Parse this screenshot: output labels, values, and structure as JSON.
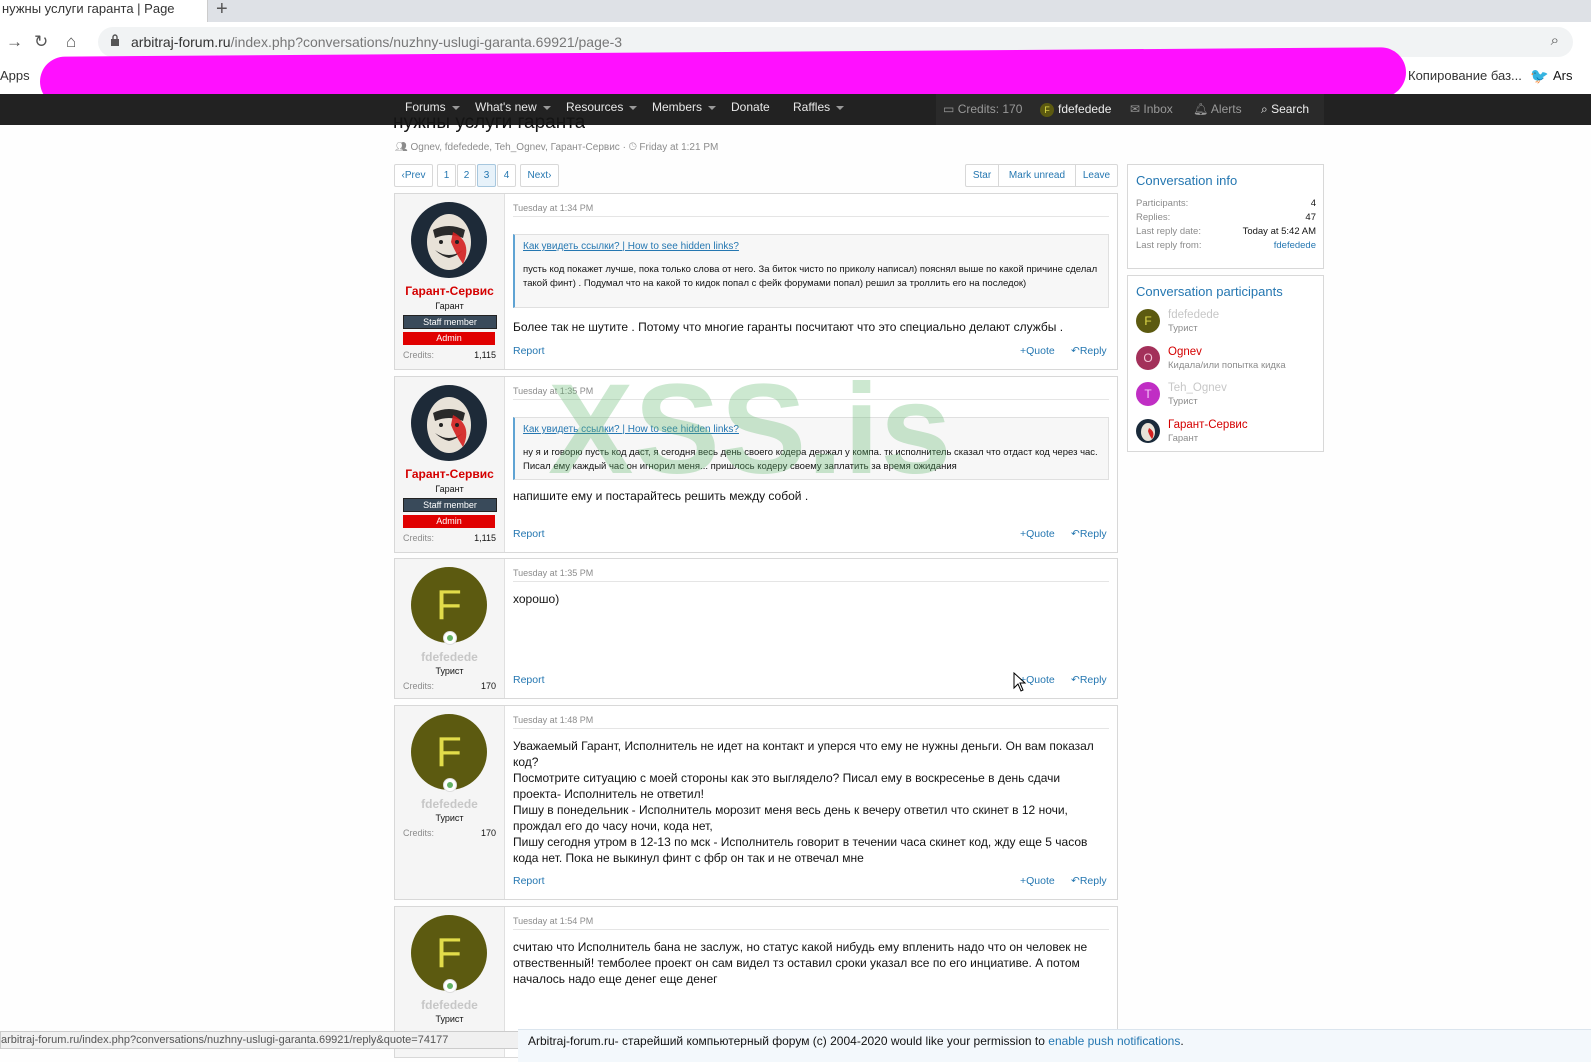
{
  "browser": {
    "tab_title": "нужны услуги гаранта | Page",
    "url_host": "arbitraj-forum.ru",
    "url_path": "/index.php?conversations/nuzhny-uslugi-garanta.69921/page-3",
    "apps_label": "Apps",
    "bookmark_right": "Копирование баз...",
    "bookmark_far": "Ars"
  },
  "nav": {
    "items": [
      "Forums",
      "What's new",
      "Resources",
      "Members",
      "Donate",
      "Raffles"
    ],
    "credits": "Credits: 170",
    "user": "fdefedede",
    "user_initial": "F",
    "inbox": "Inbox",
    "alerts": "Alerts",
    "search": "Search"
  },
  "page": {
    "title": "нужны услуги гаранта",
    "meta_participants": "Ognev, fdefedede, Teh_Ognev, Гарант-Сервис",
    "meta_date": "Friday at 1:21 PM"
  },
  "pager": {
    "prev": "Prev",
    "pages": [
      "1",
      "2",
      "3",
      "4"
    ],
    "current": "3",
    "next": "Next"
  },
  "actions": {
    "star": "Star",
    "mark_unread": "Mark unread",
    "leave": "Leave"
  },
  "messages": [
    {
      "user": "Гарант-Сервис",
      "user_title": "Гарант",
      "staff_badge": "Staff member",
      "admin_badge": "Admin",
      "credits_label": "Credits:",
      "credits": "1,115",
      "date": "Tuesday at 1:34 PM",
      "quote_link": "Как увидеть ссылки? | How to see hidden links?",
      "quote_text": "пусть код покажет лучше, пока только слова от него. За биток чисто по приколу написал) пояснял выше по какой причине сделал такой финт) . Подумал что на какой то кидок попал с фейк форумами попал) решил за троллить его на последок)",
      "body": "Более так не шутите . Потому что многие гаранты посчитают что это специально делают службы .",
      "report": "Report",
      "quote": "Quote",
      "reply": "Reply"
    },
    {
      "user": "Гарант-Сервис",
      "user_title": "Гарант",
      "staff_badge": "Staff member",
      "admin_badge": "Admin",
      "credits_label": "Credits:",
      "credits": "1,115",
      "date": "Tuesday at 1:35 PM",
      "quote_link": "Как увидеть ссылки? | How to see hidden links?",
      "quote_text": "ну я и говорю пусть код даст, я сегодня весь день своего кодера держал у компа. тк исполнитель сказал что отдаст код через час. Писал ему каждый час он игнорил меня... пришлось кодеру своему заплатить за время ожидания",
      "body": "напишите ему и постарайтесь решить между собой .",
      "report": "Report",
      "quote": "Quote",
      "reply": "Reply"
    },
    {
      "user": "fdefedede",
      "user_initial": "F",
      "user_title": "Турист",
      "credits_label": "Credits:",
      "credits": "170",
      "date": "Tuesday at 1:35 PM",
      "body": "хорошо)",
      "report": "Report",
      "quote": "Quote",
      "reply": "Reply"
    },
    {
      "user": "fdefedede",
      "user_initial": "F",
      "user_title": "Турист",
      "credits_label": "Credits:",
      "credits": "170",
      "date": "Tuesday at 1:48 PM",
      "body_lines": [
        "Уважаемый Гарант, Исполнитель не идет на контакт и уперся что ему не нужны деньги. Он вам показал код?",
        "Посмотрите ситуацию с моей стороны как это выглядело? Писал ему в воскресенье в день сдачи проекта- Исполнитель не ответил!",
        "Пишу в понедельник - Исполнитель морозит меня весь день к вечеру ответил что скинет в 12 ночи, прождал его до часу ночи, кода нет,",
        "Пишу сегодня утром в 12-13 по мск - Исполнитель говорит в течении часа скинет код, жду еще 5 часов кода нет. Пока не выкинул финт с фбр он так и не отвечал мне"
      ],
      "report": "Report",
      "quote": "Quote",
      "reply": "Reply"
    },
    {
      "user": "fdefedede",
      "user_initial": "F",
      "user_title": "Турист",
      "date": "Tuesday at 1:54 PM",
      "body": "считаю что Исполнитель бана не заслуж, но статус какой нибудь ему впленить надо что он человек не отвественный! темболее проект он сам видел тз оставил сроки указал все по его инциативе. А потом началось надо еще денег еще денег"
    }
  ],
  "sidebar": {
    "info_title": "Conversation info",
    "info": [
      {
        "label": "Participants:",
        "value": "4"
      },
      {
        "label": "Replies:",
        "value": "47"
      },
      {
        "label": "Last reply date:",
        "value": "Today at 5:42 AM"
      },
      {
        "label": "Last reply from:",
        "value": "fdefedede"
      }
    ],
    "participants_title": "Conversation participants",
    "participants": [
      {
        "initial": "F",
        "name": "fdefedede",
        "role": "Турист",
        "color": "#5c5a10"
      },
      {
        "initial": "O",
        "name": "Ognev",
        "role": "Кидала/или попытка кидка",
        "color": "#a3305a"
      },
      {
        "initial": "T",
        "name": "Teh_Ognev",
        "role": "Турист",
        "color": "#c02ec4"
      },
      {
        "initial": "",
        "name": "Гарант-Сервис",
        "role": "Гарант",
        "color": "#1a2a3a"
      }
    ]
  },
  "watermark": "XSS.is",
  "statusbar": "arbitraj-forum.ru/index.php?conversations/nuzhny-uslugi-garanta.69921/reply&quote=74177",
  "push": {
    "text": "Arbitraj-forum.ru- старейший компьютерный форум (c) 2004-2020 would like your permission to",
    "link": "enable push notifications",
    "tail": "."
  }
}
